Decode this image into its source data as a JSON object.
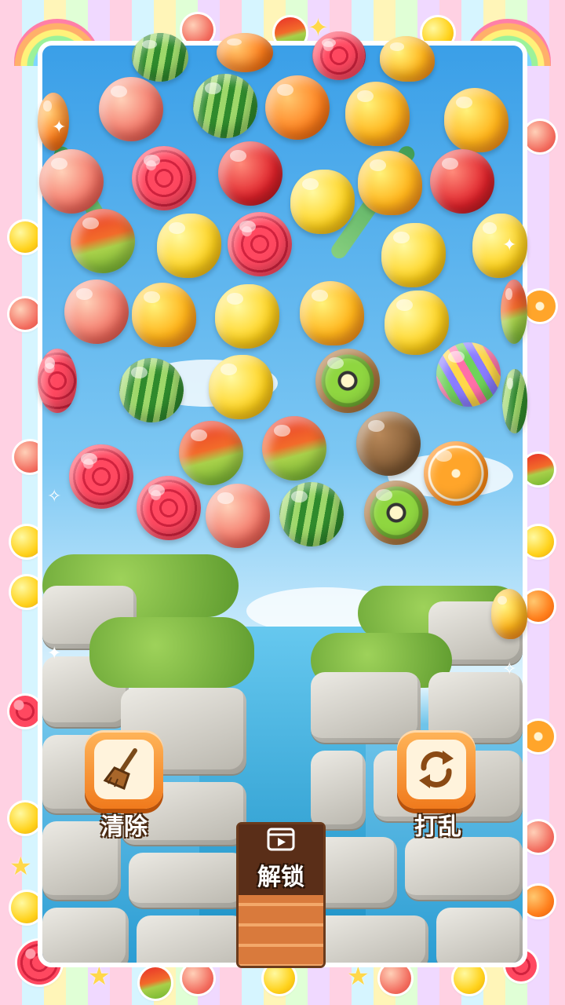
{
  "game": {
    "tools": {
      "clear_label": "清除",
      "shuffle_label": "打乱",
      "unlock_label": "解锁"
    },
    "icons": {
      "clear": "broom-icon",
      "shuffle": "shuffle-arrows-icon",
      "unlock": "video-play-icon"
    }
  }
}
